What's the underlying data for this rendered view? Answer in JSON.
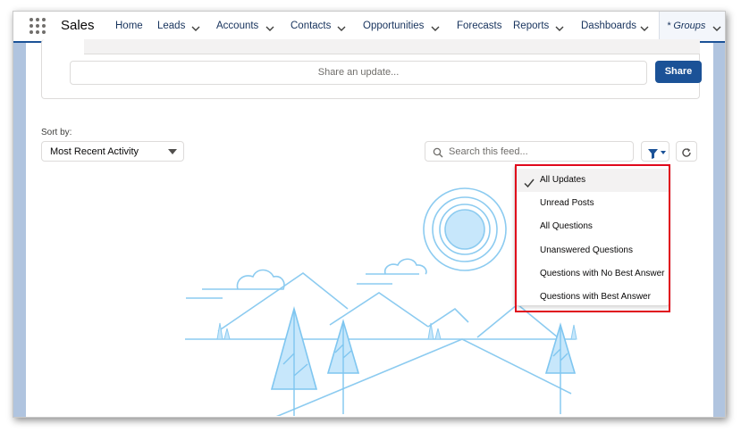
{
  "app": {
    "name": "Sales"
  },
  "nav": {
    "items": [
      {
        "label": "Home"
      },
      {
        "label": "Leads"
      },
      {
        "label": "Accounts"
      },
      {
        "label": "Contacts"
      },
      {
        "label": "Opportunities"
      },
      {
        "label": "Forecasts"
      },
      {
        "label": "Reports"
      },
      {
        "label": "Dashboards"
      }
    ],
    "active_tab": "* Groups"
  },
  "publisher": {
    "placeholder": "Share an update...",
    "share_label": "Share"
  },
  "feed": {
    "sort_label": "Sort by:",
    "sort_value": "Most Recent Activity",
    "search_placeholder": "Search this feed..."
  },
  "filter_menu": {
    "items": [
      {
        "label": "All Updates",
        "selected": true
      },
      {
        "label": "Unread Posts",
        "selected": false
      },
      {
        "label": "All Questions",
        "selected": false
      },
      {
        "label": "Unanswered Questions",
        "selected": false
      },
      {
        "label": "Questions with No Best Answer",
        "selected": false
      },
      {
        "label": "Questions with Best Answer",
        "selected": false
      }
    ]
  },
  "colors": {
    "brand": "#1b5297",
    "highlight": "#e0081b",
    "illustration": "#7fc6f0",
    "illustration_fill": "#c7e7fb"
  }
}
